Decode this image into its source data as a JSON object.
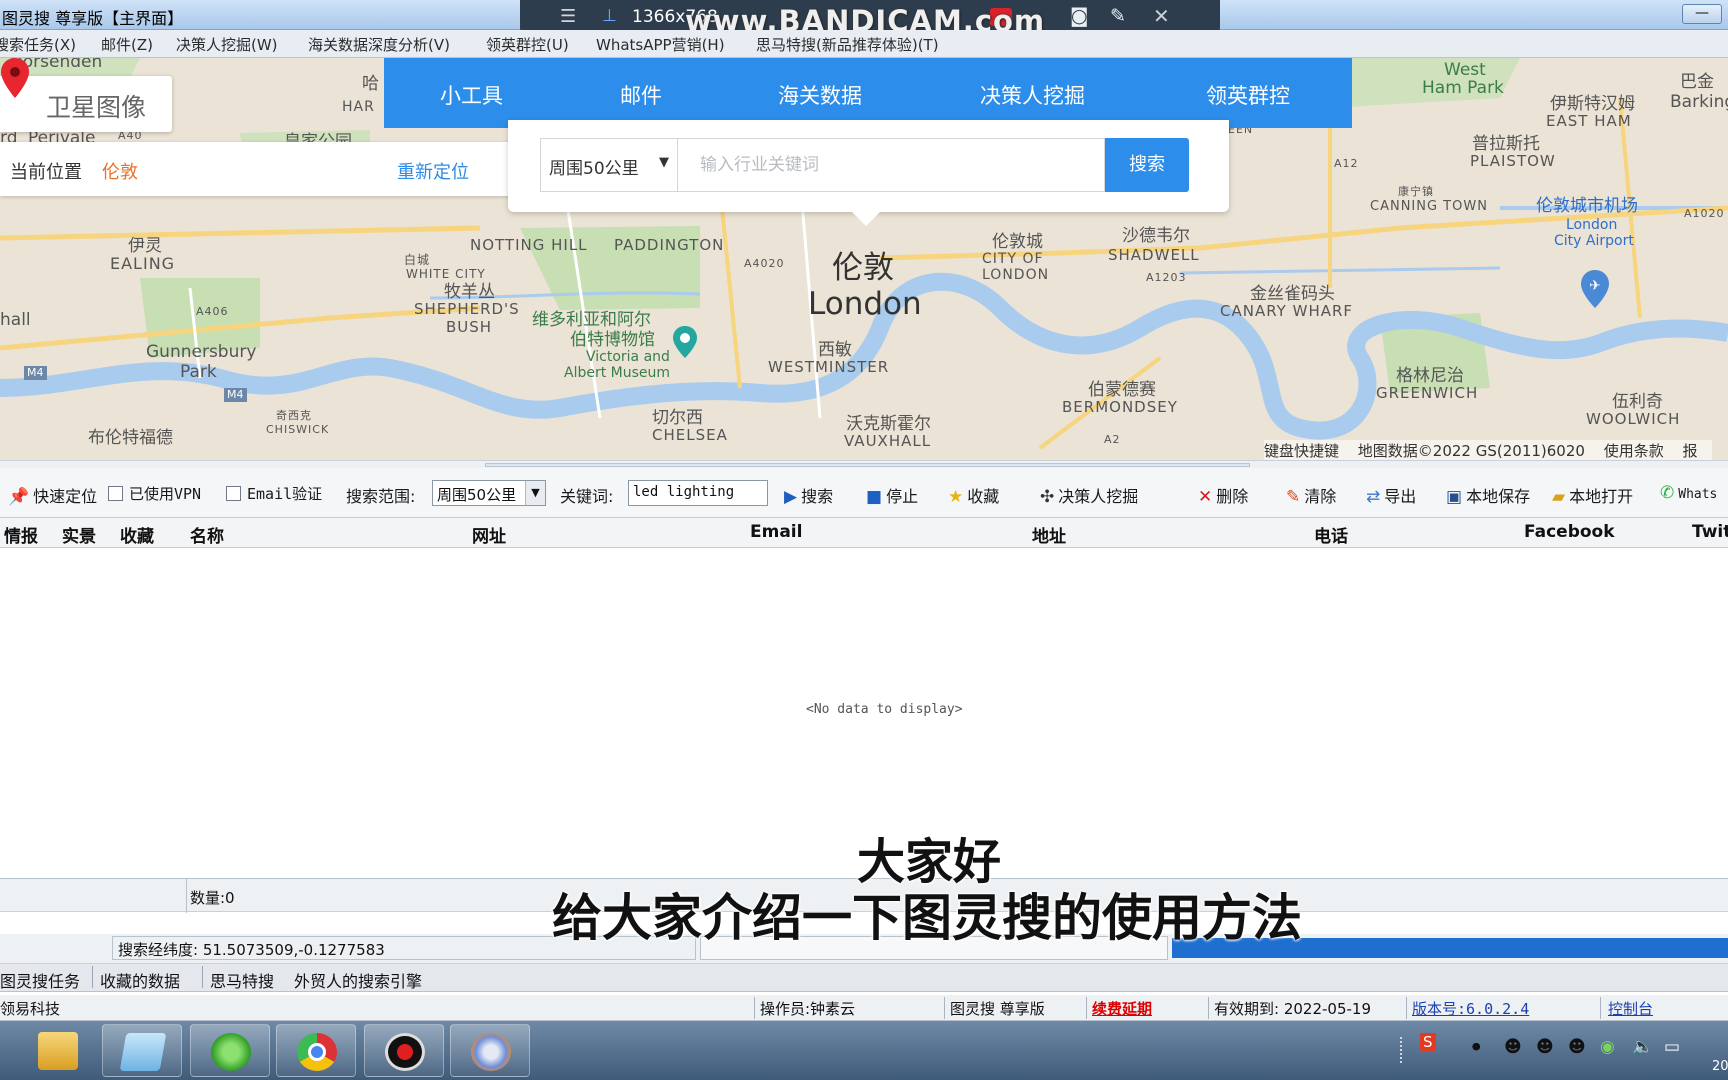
{
  "window": {
    "title": "图灵搜 尊享版【主界面】",
    "title_prefix": "图",
    "minimize_glyph": "—"
  },
  "recorder": {
    "resolution": "1366x768",
    "watermark": "www.BANDICAM.com",
    "icons": [
      "menu-icon",
      "pin-icon",
      "record-icon",
      "camera-icon",
      "pencil-icon",
      "close-icon"
    ]
  },
  "menu": {
    "items": [
      "搜索任务(X)",
      "邮件(Z)",
      "决策人挖掘(W)",
      "海关数据深度分析(V)",
      "领英群控(U)",
      "WhatsAPP营销(H)",
      "思马特搜(新品推荐体验)(T)"
    ]
  },
  "map": {
    "satellite_label": "卫星图像",
    "current_location_label": "当前位置",
    "current_city": "伦敦",
    "relocate_label": "重新定位",
    "tabs": [
      "小工具",
      "邮件",
      "海关数据",
      "决策人挖掘",
      "领英群控"
    ],
    "search": {
      "range": "周围50公里",
      "placeholder": "输入行业关键词",
      "button": "搜索"
    },
    "labels": {
      "harlesden": "Horsenden",
      "perivale": "Perivale",
      "ealing_cn": "伊灵",
      "ealing": "EALING",
      "whitecity_cn": "白城",
      "whitecity": "WHITE CITY",
      "shepherds_cn": "牧羊丛",
      "shepherds1": "SHEPHERD'S",
      "shepherds2": "BUSH",
      "notting": "NOTTING HILL",
      "paddington": "PADDINGTON",
      "vam_cn1": "维多利亚和阿尔",
      "vam_cn2": "伯特博物馆",
      "vam1": "Victoria and",
      "vam2": "Albert Museum",
      "gunnersbury1": "Gunnersbury",
      "gunnersbury2": "Park",
      "chiswick_cn": "奇西克",
      "chiswick": "CHISWICK",
      "brentford_cn": "布伦特福德",
      "chelsea_cn": "切尔西",
      "chelsea": "CHELSEA",
      "westminster_cn": "西敏",
      "westminster": "WESTMINSTER",
      "london_cn": "伦敦",
      "london": "London",
      "vauxhall_cn": "沃克斯霍尔",
      "vauxhall": "VAUXHALL",
      "city_cn": "伦敦城",
      "city1": "CITY OF",
      "city2": "LONDON",
      "shadwell_cn": "沙德韦尔",
      "shadwell": "SHADWELL",
      "bermondsey_cn": "伯蒙德赛",
      "bermondsey": "BERMONDSEY",
      "canary_cn": "金丝雀码头",
      "canary": "CANARY WHARF",
      "greenwich_cn": "格林尼治",
      "greenwich": "GREENWICH",
      "woolwich_cn": "伍利奇",
      "woolwich": "WOOLWICH",
      "eastham_cn": "伊斯特汉姆",
      "eastham": "EAST HAM",
      "plaistow_cn": "普拉斯托",
      "plaistow": "PLAISTOW",
      "westham1": "West",
      "westham2": "Ham Park",
      "barking_cn": "巴金",
      "barking": "Barking",
      "canningtown_cn": "康宁镇",
      "canningtown": "CANNING TOWN",
      "airport_cn": "伦敦城市机场",
      "airport1": "London",
      "airport2": "City Airport",
      "harrow_cn": "哈",
      "harrow": "HAR",
      "palace": "皇家公园",
      "ord": "rd",
      "hall": "hall",
      "a406": "A406",
      "a4020": "A4020",
      "a40": "A40",
      "m4a": "M4",
      "m4b": "M4",
      "a1203": "A1203",
      "a12": "A12",
      "a1020": "A1020",
      "a2": "A2",
      "een": "EEN"
    },
    "footer": [
      "键盘快捷键",
      "地图数据©2022 GS(2011)6020",
      "使用条款",
      "报"
    ]
  },
  "toolbar": {
    "quick_locate": "快速定位",
    "vpn": "已使用VPN",
    "email_verify": "Email验证",
    "range_label": "搜索范围:",
    "range_value": "周围50公里",
    "keyword_label": "关键词:",
    "keyword_value": "led lighting",
    "search": "搜索",
    "stop": "停止",
    "favorite": "收藏",
    "decision_maker": "决策人挖掘",
    "delete": "删除",
    "clear": "清除",
    "export": "导出",
    "save_local": "本地保存",
    "open_local": "本地打开",
    "whatsapp": "Whats"
  },
  "table": {
    "columns": [
      "情报",
      "实景",
      "收藏",
      "名称",
      "网址",
      "Email",
      "地址",
      "电话",
      "Facebook",
      "Twit"
    ],
    "empty_text": "<No data to display>"
  },
  "status": {
    "count": "数量:0",
    "coords": "搜索经纬度: 51.5073509,-0.1277583",
    "progress_fraction": 1.0,
    "bottom_tabs": [
      "图灵搜任务",
      "收藏的数据",
      "思马特搜",
      "外贸人的搜索引擎"
    ],
    "company": "领易科技",
    "operator": "操作员:钟素云",
    "edition": "图灵搜 尊享版",
    "renew": "续费延期",
    "expiry": "有效期到: 2022-05-19",
    "version": "版本号:6.0.2.4",
    "console": "控制台"
  },
  "subtitles": {
    "line1": "大家好",
    "line2": "给大家介绍一下图灵搜的使用方法"
  },
  "taskbar": {
    "apps": [
      "file-explorer-icon",
      "notepad-icon",
      "refresh-app-icon",
      "chrome-icon",
      "record-app-icon",
      "browser-app-icon"
    ],
    "clock": "20"
  },
  "colors": {
    "accent": "#2c8dea",
    "orange": "#e8702a",
    "progress": "#1f6fd1"
  }
}
